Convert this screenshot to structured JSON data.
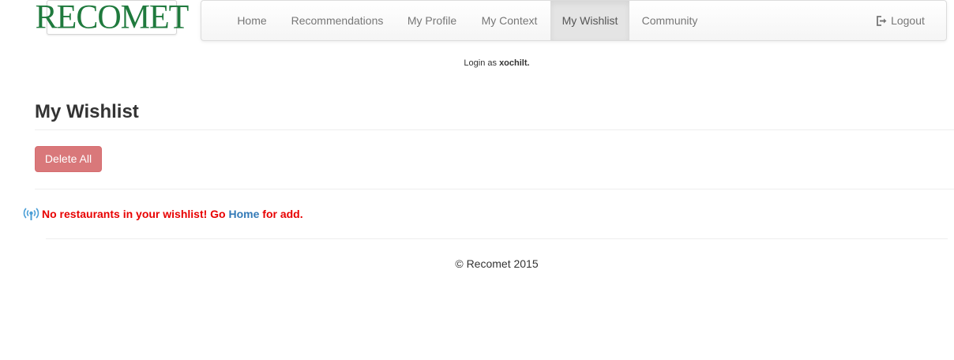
{
  "brand": {
    "logo_text": "RECOMET"
  },
  "nav": {
    "items": [
      {
        "label": "Home"
      },
      {
        "label": "Recommendations"
      },
      {
        "label": "My Profile"
      },
      {
        "label": "My Context"
      },
      {
        "label": "My Wishlist",
        "active": true
      },
      {
        "label": "Community"
      }
    ],
    "logout_label": "Logout",
    "logout_icon": "sign-out-icon"
  },
  "session": {
    "prefix": "Login as",
    "username": "xochilt."
  },
  "page": {
    "title": "My Wishlist",
    "delete_all_label": "Delete All"
  },
  "message": {
    "icon": "broadcast-icon",
    "text_before": "No restaurants in your wishlist! Go",
    "link_text": "Home",
    "text_after": "for add."
  },
  "footer": {
    "text": "© Recomet 2015"
  },
  "colors": {
    "logo_green": "#1f7a3d",
    "danger_button": "#d9787a",
    "alert_red": "#e80000",
    "link_blue": "#337ab7",
    "icon_blue": "#4a9ed6"
  }
}
